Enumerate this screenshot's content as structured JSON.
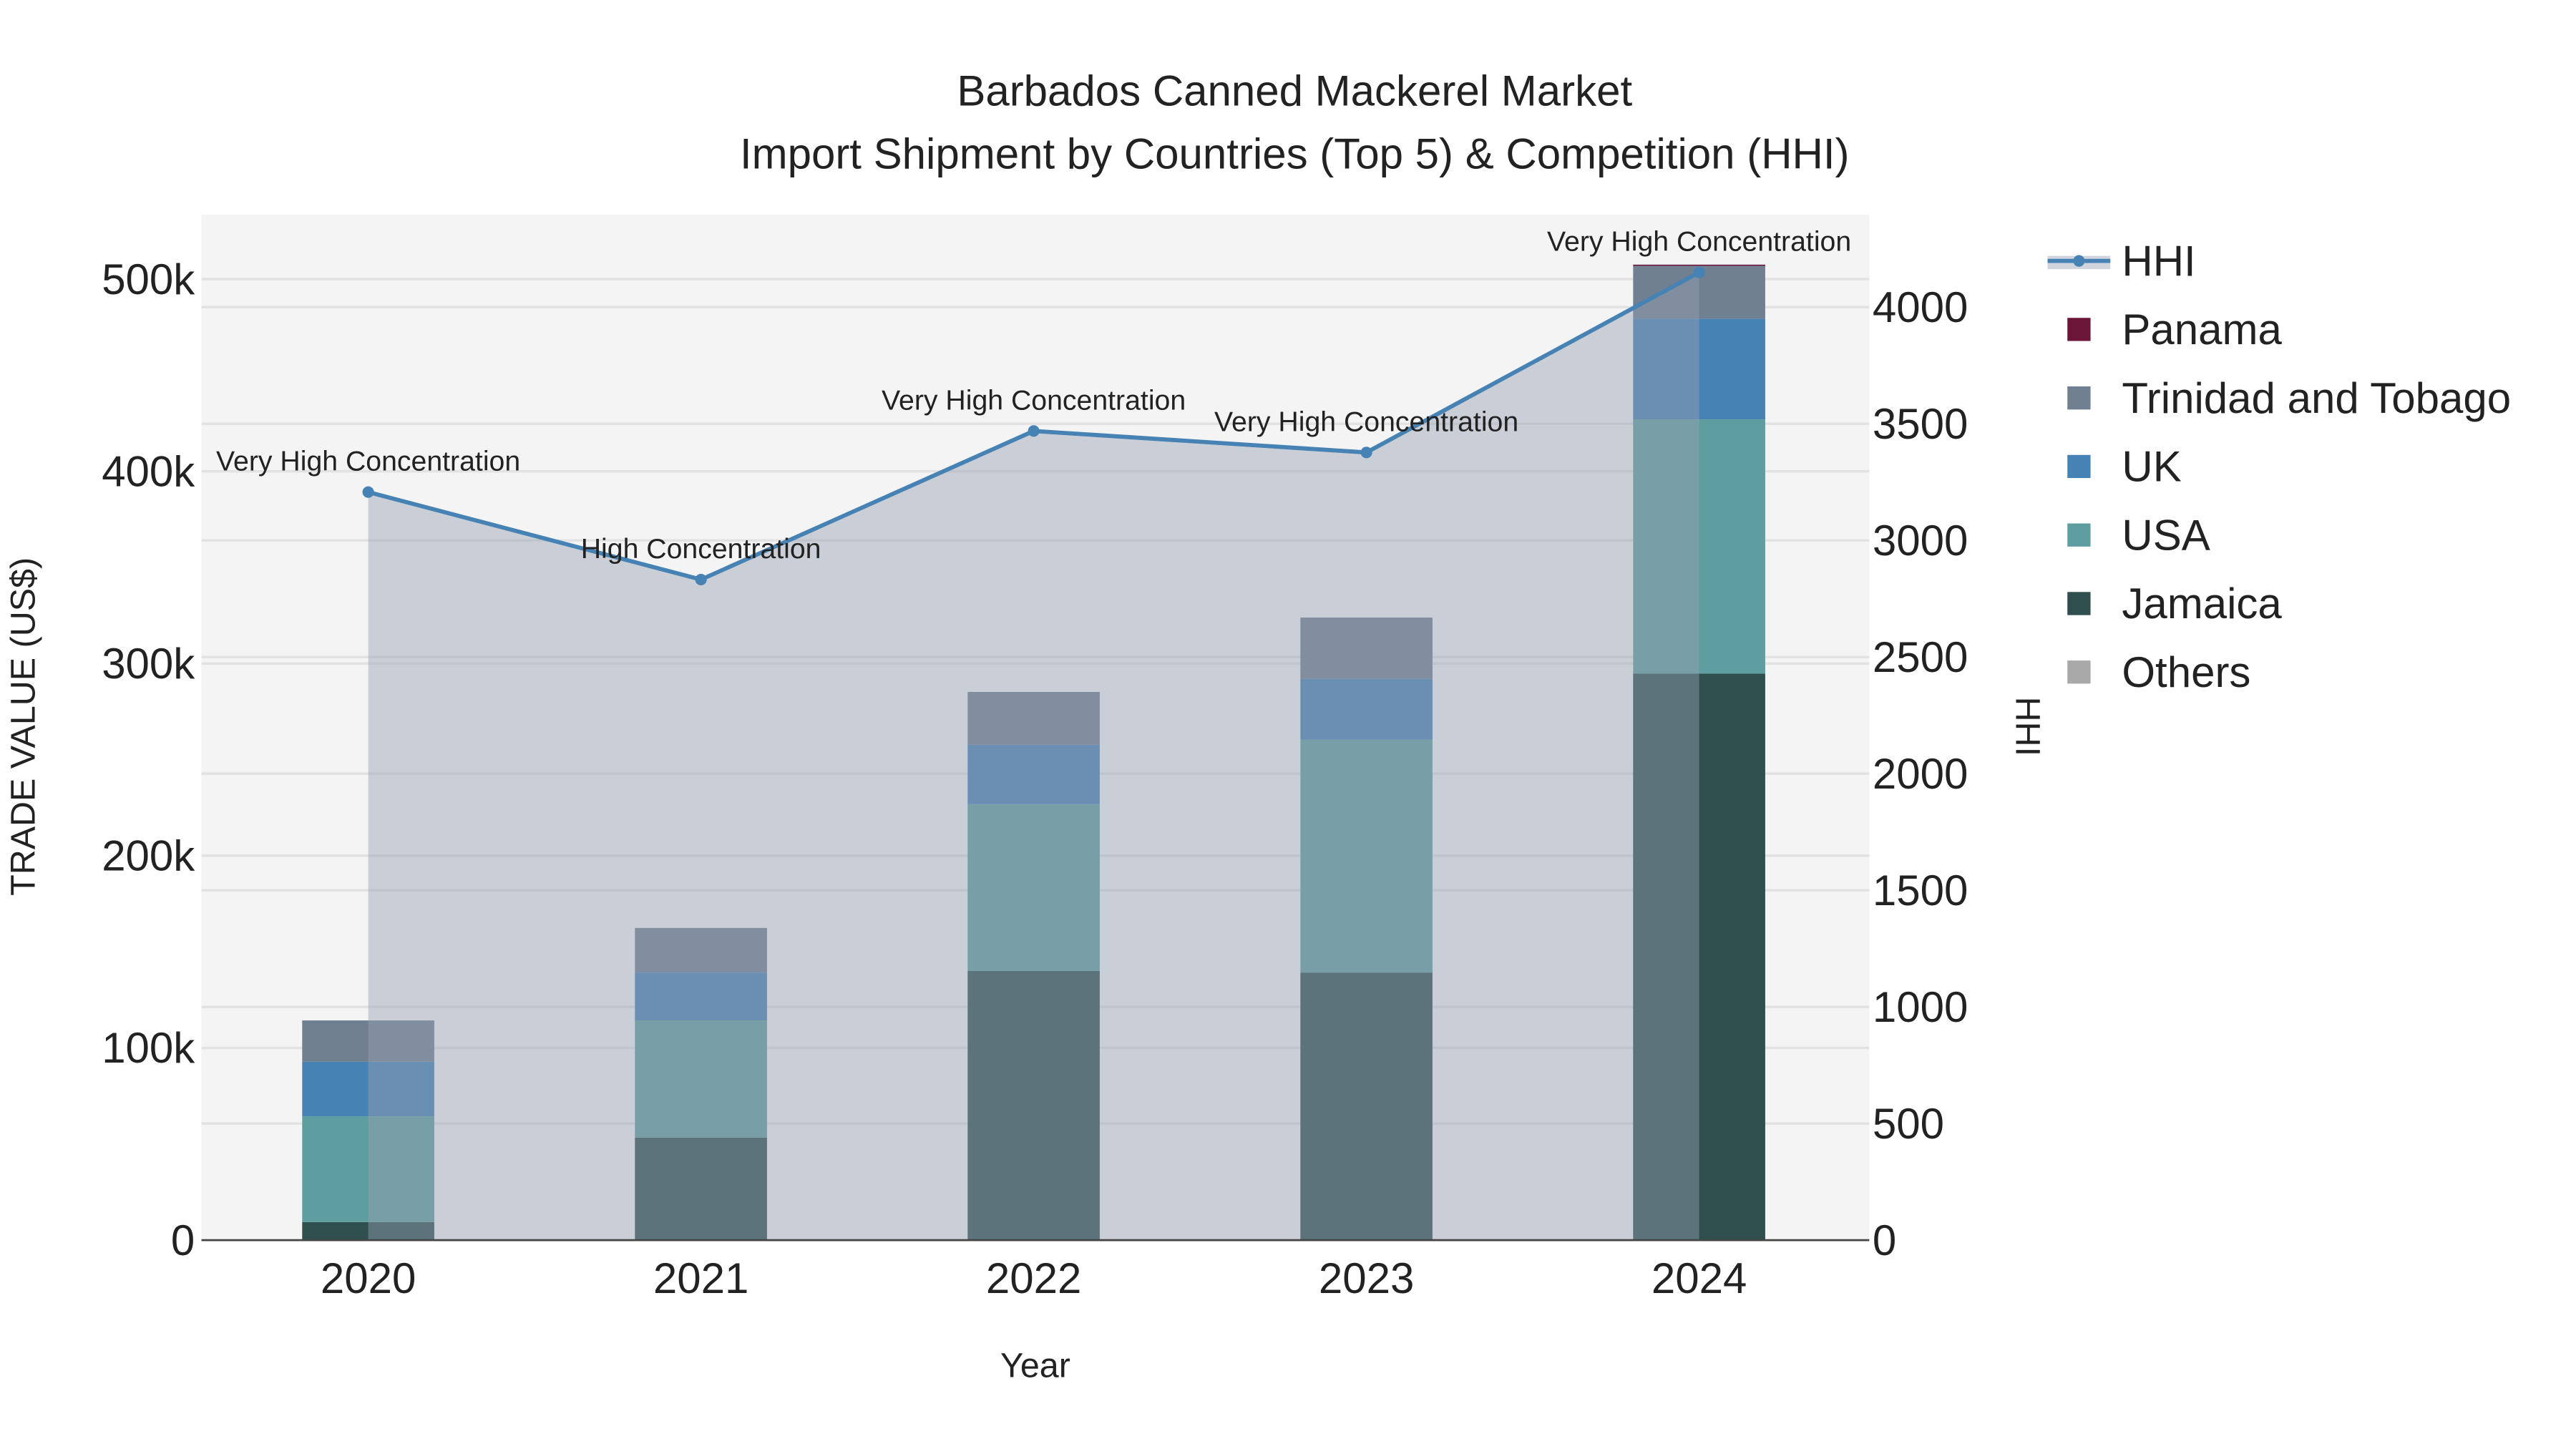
{
  "chart_data": {
    "type": "bar",
    "title_line1": "Barbados Canned Mackerel Market",
    "title_line2": "Import Shipment by Countries (Top 5) & Competition (HHI)",
    "xlabel": "Year",
    "ylabel": "TRADE VALUE (US$)",
    "y2label": "HHI",
    "categories": [
      "2020",
      "2021",
      "2022",
      "2023",
      "2024"
    ],
    "ylim": [
      0,
      532000
    ],
    "y2lim": [
      0,
      4400
    ],
    "yticks": [
      0,
      100000,
      200000,
      300000,
      400000,
      500000
    ],
    "ytick_labels": [
      "0",
      "100k",
      "200k",
      "300k",
      "400k",
      "500k"
    ],
    "y2ticks": [
      0,
      500,
      1000,
      1500,
      2000,
      2500,
      3000,
      3500,
      4000
    ],
    "y2tick_labels": [
      "0",
      "500",
      "1000",
      "1500",
      "2000",
      "2500",
      "3000",
      "3500",
      "4000"
    ],
    "grid": true,
    "legend_placement": "right",
    "series": [
      {
        "name": "Jamaica",
        "color": "#2f4f4f",
        "values": [
          9400,
          53300,
          140000,
          139200,
          294700
        ]
      },
      {
        "name": "USA",
        "color": "#5f9ea0",
        "values": [
          55000,
          61000,
          86800,
          121100,
          132300
        ]
      },
      {
        "name": "UK",
        "color": "#4682b4",
        "values": [
          28400,
          24900,
          30900,
          31700,
          52400
        ]
      },
      {
        "name": "Trinidad and Tobago",
        "color": "#708090",
        "values": [
          21500,
          23200,
          27500,
          31900,
          27500
        ]
      },
      {
        "name": "Panama",
        "color": "#6b1538",
        "values": [
          0,
          0,
          0,
          0,
          600
        ]
      },
      {
        "name": "Others",
        "color": "#a9a9a9",
        "values": [
          0,
          0,
          0,
          0,
          0
        ]
      }
    ],
    "hhi": {
      "name": "HHI",
      "color": "#4682b4",
      "values": [
        3207,
        2832,
        3469,
        3377,
        4149
      ],
      "annotations": [
        "Very High Concentration",
        "High Concentration",
        "Very High Concentration",
        "Very High Concentration",
        "Very High Concentration"
      ]
    },
    "legend_order": [
      "HHI",
      "Panama",
      "Trinidad and Tobago",
      "UK",
      "USA",
      "Jamaica",
      "Others"
    ]
  }
}
